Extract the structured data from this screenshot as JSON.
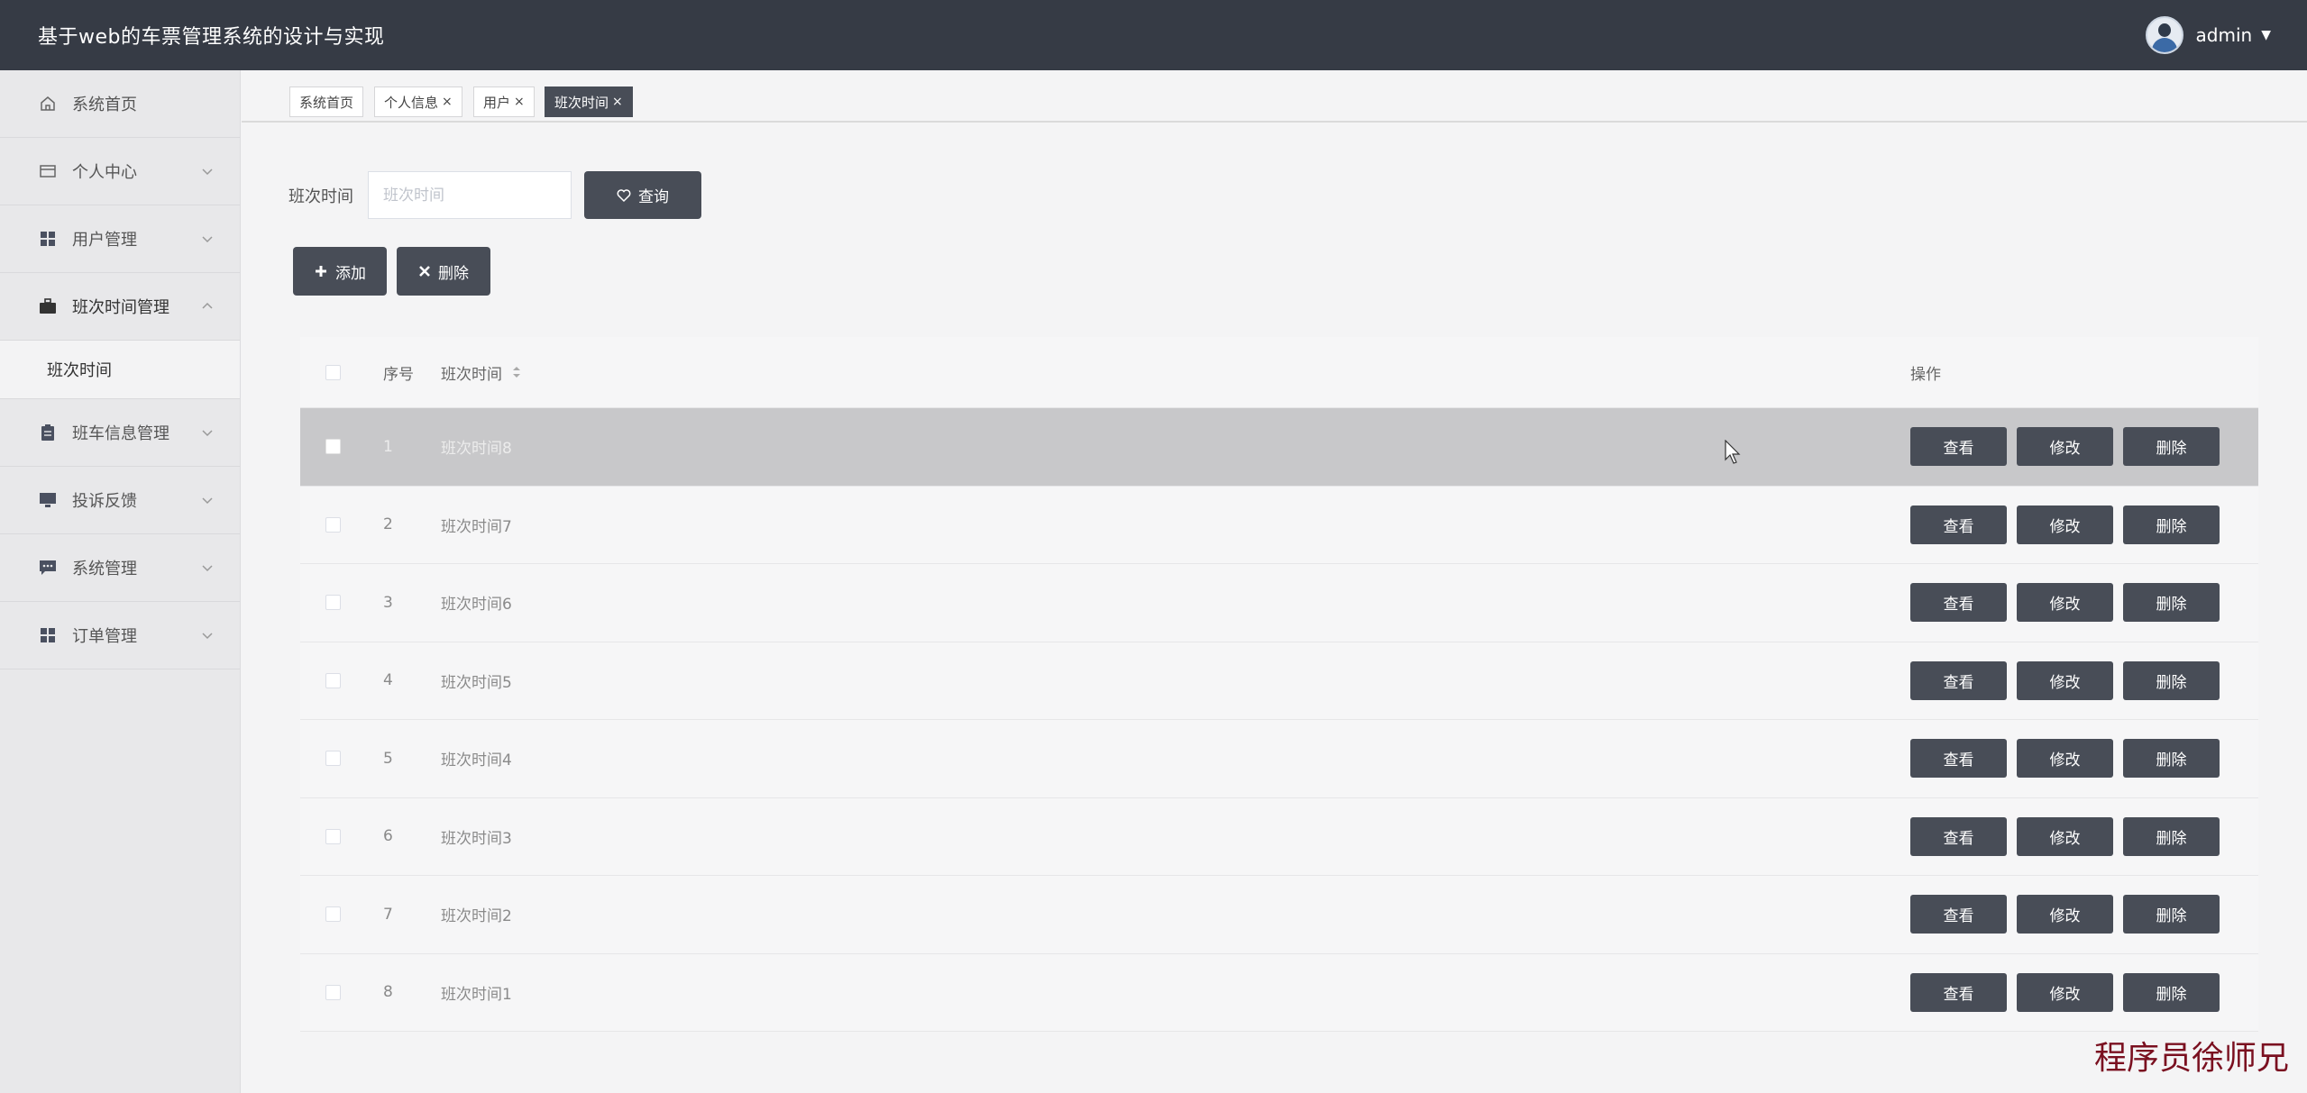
{
  "header": {
    "title": "基于web的车票管理系统的设计与实现",
    "username": "admin"
  },
  "sidebar": {
    "items": [
      {
        "label": "系统首页"
      },
      {
        "label": "个人中心"
      },
      {
        "label": "用户管理"
      },
      {
        "label": "班次时间管理"
      },
      {
        "label": "班车信息管理"
      },
      {
        "label": "投诉反馈"
      },
      {
        "label": "系统管理"
      },
      {
        "label": "订单管理"
      }
    ],
    "submenu": {
      "label": "班次时间"
    }
  },
  "tabs": [
    {
      "label": "系统首页",
      "close": ""
    },
    {
      "label": "个人信息",
      "close": "×"
    },
    {
      "label": "用户",
      "close": "×"
    },
    {
      "label": "班次时间",
      "close": "×"
    }
  ],
  "search": {
    "label": "班次时间",
    "placeholder": "班次时间",
    "value": "",
    "button": "查询"
  },
  "actions": {
    "add": "添加",
    "delete": "删除"
  },
  "table": {
    "headers": {
      "index": "序号",
      "name": "班次时间",
      "ops": "操作"
    },
    "rows": [
      {
        "index": "1",
        "name": "班次时间8"
      },
      {
        "index": "2",
        "name": "班次时间7"
      },
      {
        "index": "3",
        "name": "班次时间6"
      },
      {
        "index": "4",
        "name": "班次时间5"
      },
      {
        "index": "5",
        "name": "班次时间4"
      },
      {
        "index": "6",
        "name": "班次时间3"
      },
      {
        "index": "7",
        "name": "班次时间2"
      },
      {
        "index": "8",
        "name": "班次时间1"
      }
    ],
    "row_buttons": {
      "view": "查看",
      "edit": "修改",
      "delete": "删除"
    }
  },
  "watermark": "程序员徐师兄",
  "colors": {
    "header": "#363b45",
    "button": "#484d57",
    "sidebar": "#e8e8ea",
    "watermark": "#7a1020"
  }
}
